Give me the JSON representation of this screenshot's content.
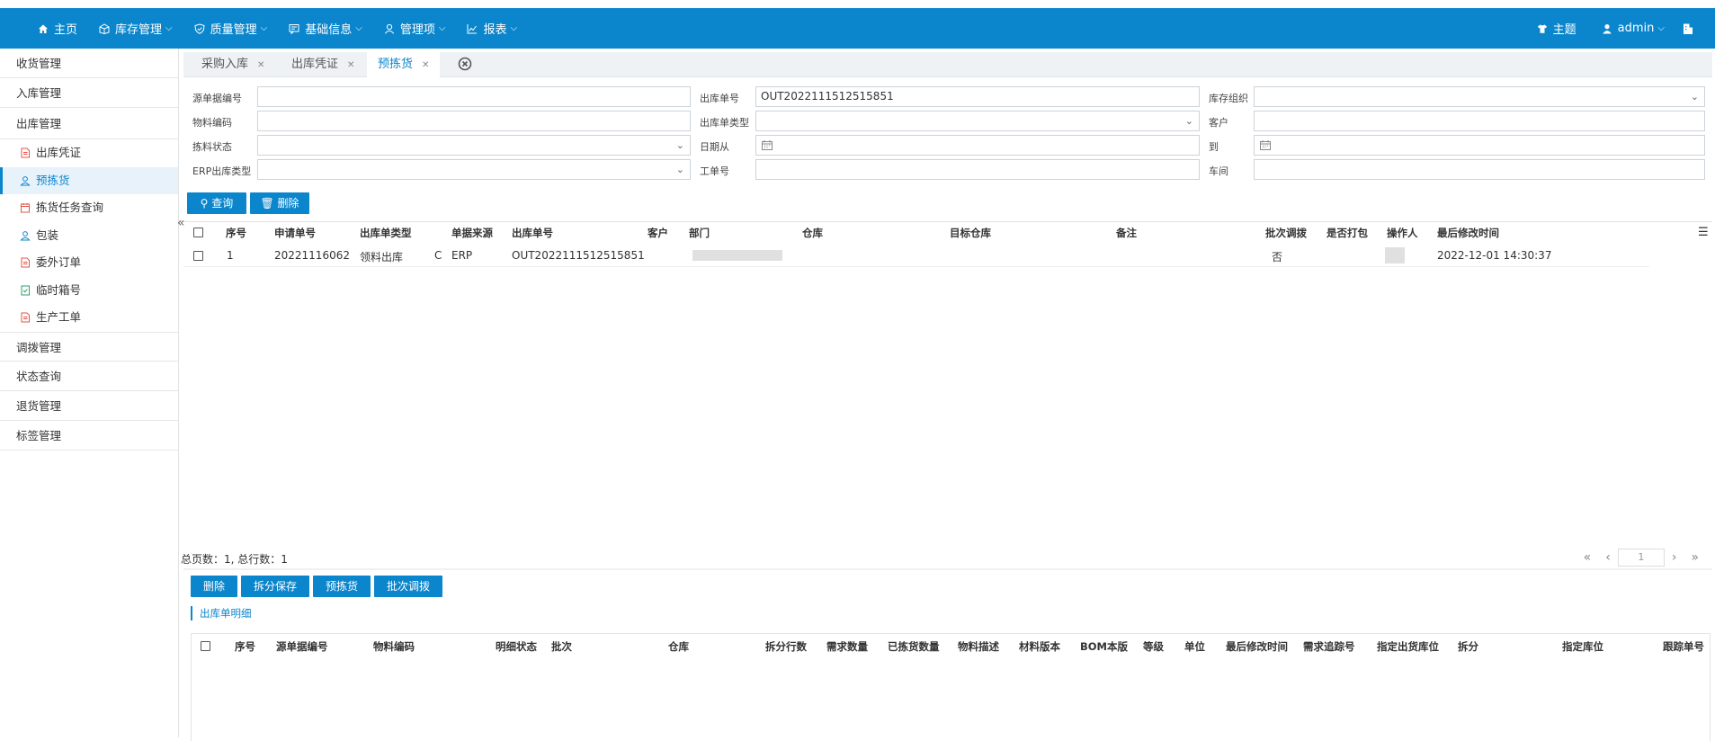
{
  "topbar": {
    "nav": [
      {
        "label": "主页",
        "icon": "home-icon",
        "dropdown": false
      },
      {
        "label": "库存管理",
        "icon": "box-icon",
        "dropdown": true
      },
      {
        "label": "质量管理",
        "icon": "shield-icon",
        "dropdown": true
      },
      {
        "label": "基础信息",
        "icon": "message-icon",
        "dropdown": true
      },
      {
        "label": "管理项",
        "icon": "user-icon",
        "dropdown": true
      },
      {
        "label": "报表",
        "icon": "chart-icon",
        "dropdown": true
      }
    ],
    "right": {
      "theme_label": "主题",
      "user_label": "admin"
    }
  },
  "sidebar": {
    "groups_top": [
      "收货管理",
      "入库管理",
      "出库管理"
    ],
    "sub_items": [
      "出库凭证",
      "预拣货",
      "拣货任务查询",
      "包装",
      "委外订单",
      "临时箱号",
      "生产工单"
    ],
    "groups_bottom": [
      "调拨管理",
      "状态查询",
      "退货管理",
      "标签管理"
    ],
    "collapse_glyph": "«"
  },
  "tabs": [
    {
      "label": "采购入库"
    },
    {
      "label": "出库凭证"
    },
    {
      "label": "预拣货"
    }
  ],
  "form": {
    "source_no_label": "源单据编号",
    "out_no_label": "出库单号",
    "out_no_value": "OUT2022111512515851",
    "org_label": "库存组织",
    "material_label": "物料编码",
    "out_type_label": "出库单类型",
    "customer_label": "客户",
    "pick_status_label": "拣料状态",
    "date_from_label": "日期从",
    "date_to_label": "到",
    "erp_type_label": "ERP出库类型",
    "work_order_label": "工单号",
    "workshop_label": "车间"
  },
  "buttons": {
    "query": "查询",
    "delete": "删除"
  },
  "grid": {
    "headers": [
      "序号",
      "申请单号",
      "出库单类型",
      "单据来源",
      "出库单号",
      "客户",
      "部门",
      "仓库",
      "目标仓库",
      "备注",
      "批次调拨",
      "是否打包",
      "操作人",
      "最后修改时间"
    ],
    "rows": [
      {
        "seq": "1",
        "apply_no": "20221116062",
        "out_type": "领料出库",
        "c": "C",
        "source": "ERP",
        "out_no": "OUT2022111512515851",
        "batch": "否",
        "modified": "2022-12-01 14:30:37"
      }
    ],
    "pager_info": "总页数：1, 总行数：1",
    "page_value": "1"
  },
  "bottom_buttons": {
    "delete": "删除",
    "split_save": "拆分保存",
    "pre_pick": "预拣货",
    "batch_transfer": "批次调拨"
  },
  "detail": {
    "title": "出库单明细",
    "headers": [
      "序号",
      "源单据编号",
      "物料编码",
      "明细状态",
      "批次",
      "仓库",
      "拆分行数",
      "需求数量",
      "已拣货数量",
      "物料描述",
      "材料版本",
      "BOM本版",
      "等级",
      "单位",
      "最后修改时间",
      "需求追踪号",
      "指定出货库位",
      "拆分",
      "指定库位",
      "跟踪单号"
    ]
  },
  "colors": {
    "primary": "#0b86cc"
  }
}
